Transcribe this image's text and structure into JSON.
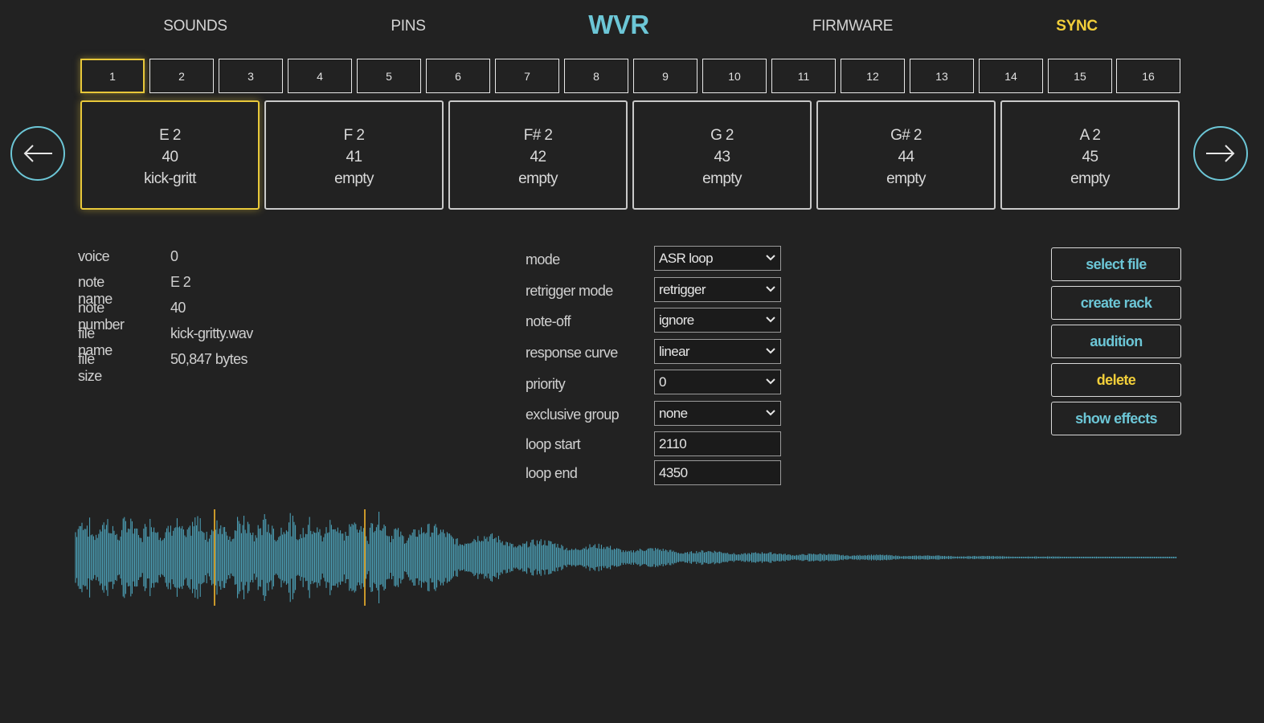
{
  "nav": {
    "sounds": "SOUNDS",
    "pins": "PINS",
    "title": "WVR",
    "firmware": "FIRMWARE",
    "sync": "SYNC"
  },
  "banks": [
    "1",
    "2",
    "3",
    "4",
    "5",
    "6",
    "7",
    "8",
    "9",
    "10",
    "11",
    "12",
    "13",
    "14",
    "15",
    "16"
  ],
  "active_bank": "1",
  "cards": [
    {
      "note": "E 2",
      "number": "40",
      "file": "kick-gritt"
    },
    {
      "note": "F 2",
      "number": "41",
      "file": "empty"
    },
    {
      "note": "F# 2",
      "number": "42",
      "file": "empty"
    },
    {
      "note": "G 2",
      "number": "43",
      "file": "empty"
    },
    {
      "note": "G# 2",
      "number": "44",
      "file": "empty"
    },
    {
      "note": "A 2",
      "number": "45",
      "file": "empty"
    }
  ],
  "info": {
    "voice_label": "voice",
    "voice": "0",
    "note_name_label": "note name",
    "note_name": "E 2",
    "note_number_label": "note number",
    "note_number": "40",
    "file_name_label": "file name",
    "file_name": "kick-gritty.wav",
    "file_size_label": "file size",
    "file_size": "50,847 bytes"
  },
  "params": {
    "mode_label": "mode",
    "mode": "ASR loop",
    "retrigger_label": "retrigger mode",
    "retrigger": "retrigger",
    "noteoff_label": "note-off",
    "noteoff": "ignore",
    "curve_label": "response curve",
    "curve": "linear",
    "priority_label": "priority",
    "priority": "0",
    "exclusive_label": "exclusive group",
    "exclusive": "none",
    "loop_start_label": "loop start",
    "loop_start": "2110",
    "loop_end_label": "loop end",
    "loop_end": "4350"
  },
  "actions": {
    "select_file": "select file",
    "create_rack": "create rack",
    "audition": "audition",
    "delete": "delete",
    "show_effects": "show effects"
  },
  "colors": {
    "accent": "#6cc6d6",
    "highlight": "#e8c83a",
    "background": "#222222",
    "waveform": "#4fa8c0",
    "loop_marker": "#c9982a"
  }
}
